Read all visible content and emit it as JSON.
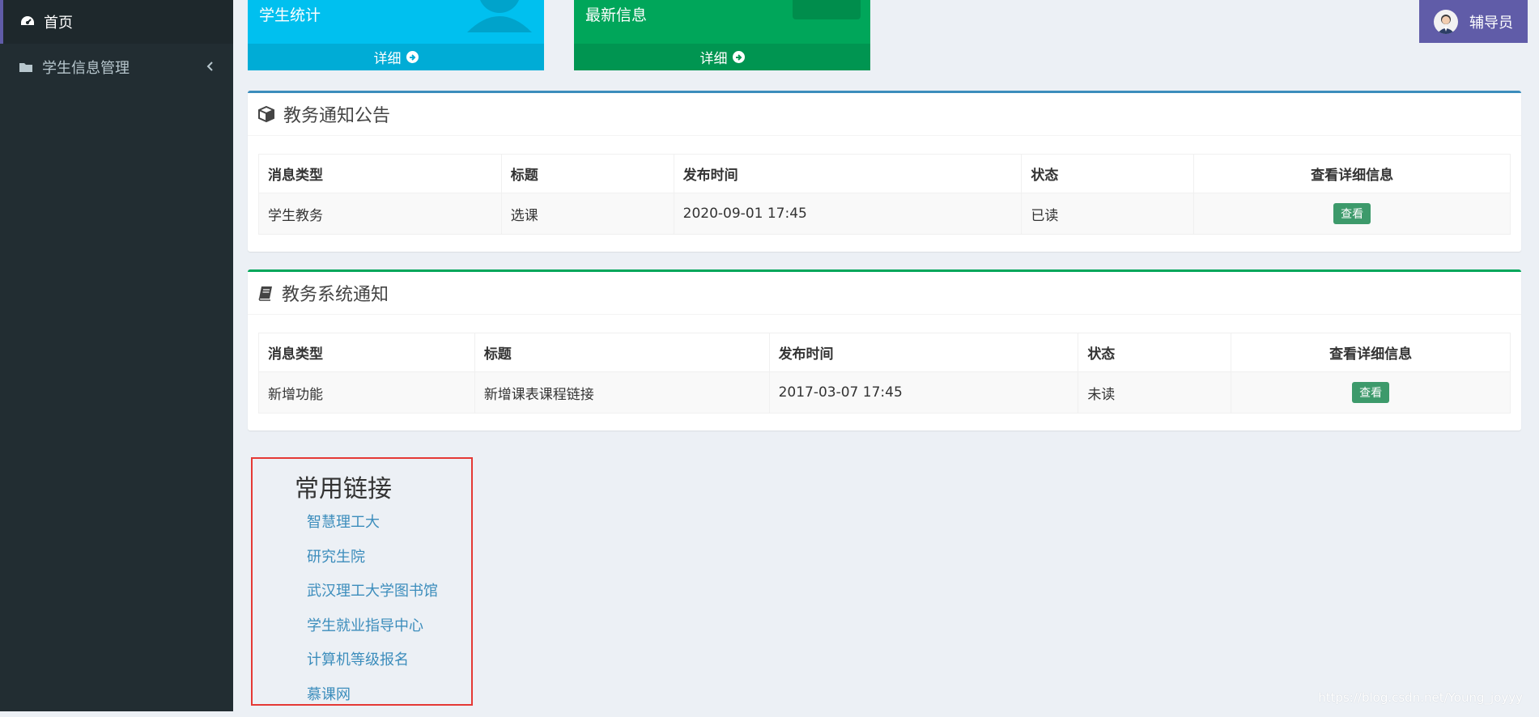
{
  "sidebar": {
    "items": [
      {
        "label": "首页",
        "icon": "dashboard-icon"
      },
      {
        "label": "学生信息管理",
        "icon": "folder-icon"
      }
    ]
  },
  "user": {
    "name": "辅导员"
  },
  "boxes": [
    {
      "title": "学生统计",
      "footer": "详细",
      "color": "#00c0ef",
      "footer_color": "#00acd6"
    },
    {
      "title": "最新信息",
      "footer": "详细",
      "color": "#00a65a",
      "footer_color": "#009551"
    }
  ],
  "notice_panel": {
    "title": "教务通知公告",
    "accent": "#3c8dbc",
    "headers": [
      "消息类型",
      "标题",
      "发布时间",
      "状态",
      "查看详细信息"
    ],
    "rows": [
      {
        "type": "学生教务",
        "title": "选课",
        "time": "2020-09-01 17:45",
        "status": "已读",
        "action": "查看"
      }
    ]
  },
  "system_panel": {
    "title": "教务系统通知",
    "accent": "#00a65a",
    "headers": [
      "消息类型",
      "标题",
      "发布时间",
      "状态",
      "查看详细信息"
    ],
    "rows": [
      {
        "type": "新增功能",
        "title": "新增课表课程链接",
        "time": "2017-03-07 17:45",
        "status": "未读",
        "action": "查看"
      }
    ]
  },
  "links": {
    "title": "常用链接",
    "items": [
      "智慧理工大",
      "研究生院",
      "武汉理工大学图书馆",
      "学生就业指导中心",
      "计算机等级报名",
      "慕课网"
    ]
  },
  "watermark": "https://blog.csdn.net/Young_joyyy"
}
